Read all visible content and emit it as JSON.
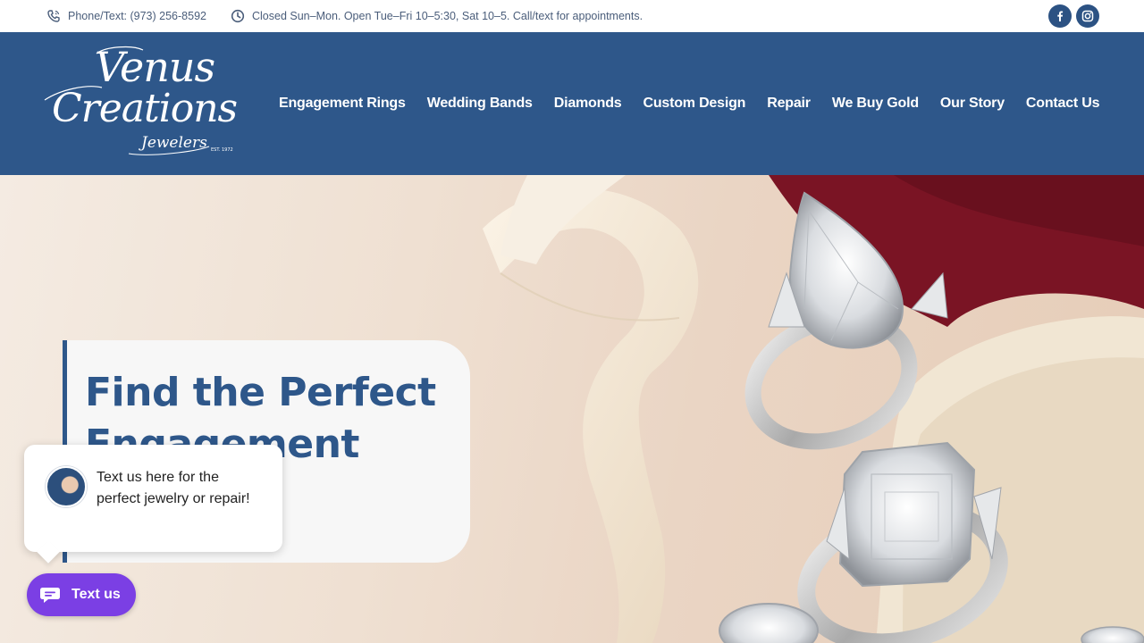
{
  "topbar": {
    "phone_text": "Phone/Text: (973) 256-8592",
    "hours_text": "Closed Sun–Mon. Open Tue–Fri 10–5:30, Sat 10–5. Call/text for appointments.",
    "social": [
      {
        "name": "facebook",
        "icon": "facebook-icon"
      },
      {
        "name": "instagram",
        "icon": "instagram-icon"
      }
    ]
  },
  "logo": {
    "line1": "Venus",
    "line2": "Creations",
    "line3": "Jewelers",
    "est": "EST. 1972"
  },
  "nav": {
    "items": [
      {
        "label": "Engagement Rings"
      },
      {
        "label": "Wedding Bands"
      },
      {
        "label": "Diamonds"
      },
      {
        "label": "Custom Design"
      },
      {
        "label": "Repair"
      },
      {
        "label": "We Buy Gold"
      },
      {
        "label": "Our Story"
      },
      {
        "label": "Contact Us"
      }
    ]
  },
  "hero": {
    "title": "Find the Perfect Engagement Ring"
  },
  "chat": {
    "message": "Text us here for the perfect jewelry or repair!",
    "button_label": "Text us"
  },
  "colors": {
    "brand_blue": "#2e578a",
    "chat_purple": "#7b3fe4",
    "card_bg": "#f7f7f7"
  }
}
